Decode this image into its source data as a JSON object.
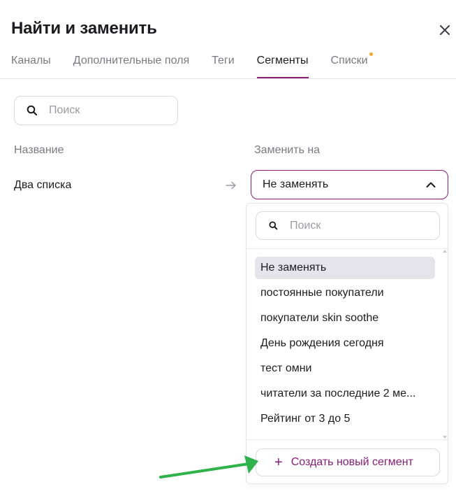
{
  "dialog": {
    "title": "Найти и заменить",
    "close_icon": "close-icon"
  },
  "tabs": [
    {
      "label": "Каналы",
      "active": false
    },
    {
      "label": "Дополнительные поля",
      "active": false
    },
    {
      "label": "Теги",
      "active": false
    },
    {
      "label": "Сегменты",
      "active": true
    },
    {
      "label": "Списки",
      "active": false,
      "notification_dot": true
    }
  ],
  "search": {
    "placeholder": "Поиск",
    "icon": "search-icon"
  },
  "columns": {
    "name": "Название",
    "replace_with": "Заменить на"
  },
  "row": {
    "name": "Два списка",
    "arrow_icon": "arrow-right-icon"
  },
  "select": {
    "value": "Не заменять",
    "icon": "chevron-up-icon"
  },
  "dropdown": {
    "search_placeholder": "Поиск",
    "options": [
      "Не заменять",
      "постоянные покупатели",
      "покупатели skin soothe",
      "День рождения сегодня",
      "тест омни",
      "читатели за последние 2 ме...",
      "Рейтинг от 3 до 5"
    ],
    "selected": "Не заменять",
    "create_label": "Создать новый сегмент",
    "create_icon": "plus-icon"
  },
  "colors": {
    "accent": "#8a1c78",
    "notification_dot": "#f5a623",
    "annotation_arrow": "#2eb34a",
    "selected_option_bg": "#e4e4ea"
  }
}
